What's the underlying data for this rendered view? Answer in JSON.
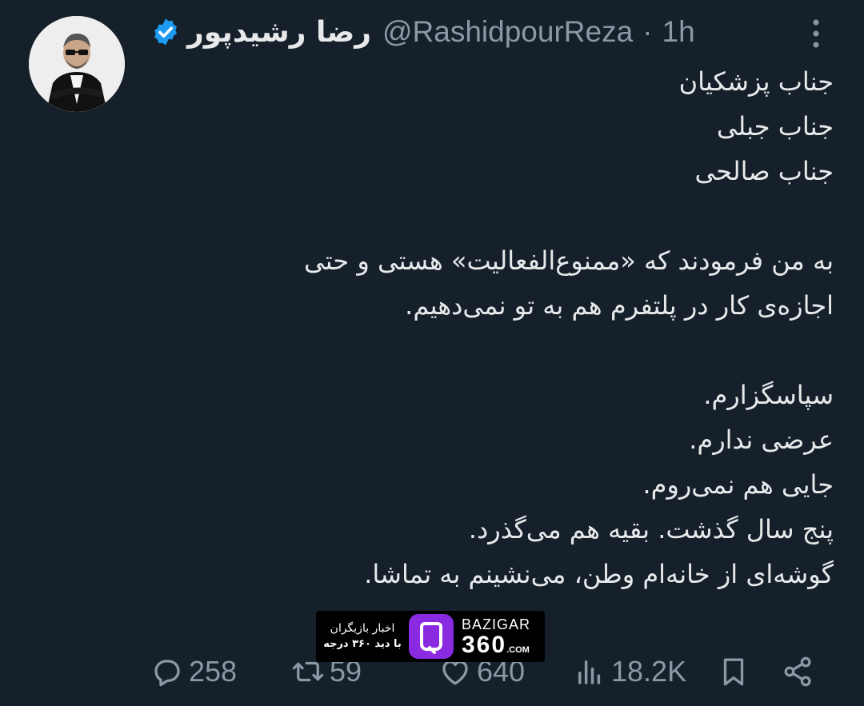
{
  "author": {
    "display_name": "رضا رشیدپور",
    "handle": "@RashidpourReza",
    "separator": "·",
    "time": "1h",
    "verified_icon": "verified-badge-icon",
    "colors": {
      "verified": "#1d9bf0"
    }
  },
  "tweet": {
    "lines": [
      "جناب پزشکیان",
      "جناب جبلی",
      "جناب صالحی",
      "",
      "به من فرمودند که «ممنوع‌الفعالیت» هستی و حتی",
      "اجازه‌ی کار در پلتفرم هم به تو نمی‌دهیم.",
      "",
      "سپاسگزارم.",
      "عرضی ندارم.",
      "جایی هم نمی‌روم.",
      "پنج سال گذشت. بقیه هم می‌گذرد.",
      "گوشه‌ای از خانه‌ام وطن، می‌نشینم به تماشا."
    ]
  },
  "actions": {
    "replies": "258",
    "retweets": "59",
    "likes": "640",
    "views": "18.2K"
  },
  "watermark": {
    "line1": "اخبار بازیگران",
    "line2": "با دید ۳۶۰ درجه",
    "brand": "BAZIGAR",
    "number": "360",
    "suffix": ".COM",
    "colors": {
      "logo": "#8a2be2"
    }
  },
  "colors": {
    "background": "#15202b",
    "text": "#e7e9ea",
    "muted": "#8b98a5"
  }
}
